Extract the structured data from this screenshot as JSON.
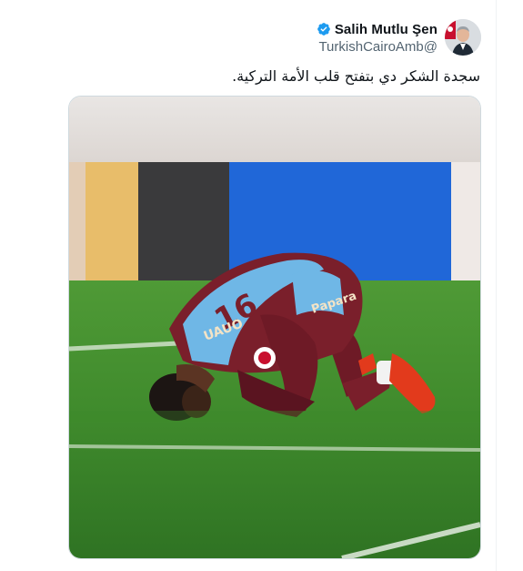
{
  "tweet": {
    "author": {
      "display_name": "Salih Mutlu Şen",
      "handle": "TurkishCairoAmb@",
      "verified": true,
      "avatar_icon": "person-avatar"
    },
    "text": "سجدة الشكر دي بتفتح قلب الأمة التركية.",
    "media": {
      "type": "photo",
      "jersey_text": "Papara",
      "icon": "photo"
    }
  },
  "colors": {
    "verified_blue": "#1d9bf0",
    "text_primary": "#0f1419",
    "text_secondary": "#536471",
    "pitch_green": "#3f8a2c",
    "jersey_maroon": "#7a1f2b",
    "jersey_blue": "#6fb7e6"
  }
}
